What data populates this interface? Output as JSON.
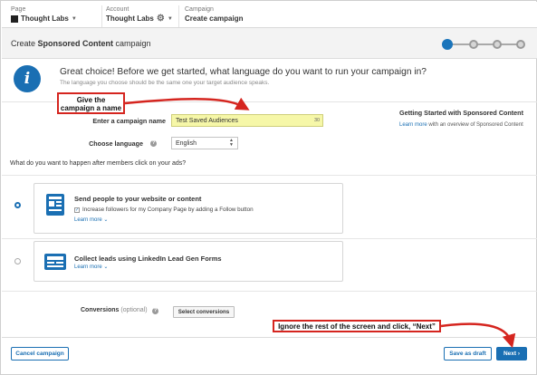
{
  "breadcrumb": {
    "page_label": "Page",
    "page_value": "Thought Labs",
    "account_label": "Account",
    "account_value": "Thought Labs",
    "campaign_label": "Campaign",
    "campaign_value": "Create campaign"
  },
  "header": {
    "title_prefix": "Create ",
    "title_bold": "Sponsored Content",
    "title_suffix": " campaign",
    "progress": {
      "current_step": 1,
      "total_steps": 4
    }
  },
  "banner": {
    "heading": "Great choice! Before we get started, what language do you want to run your campaign in?",
    "subtext": "The language you choose should be the same one your target audience speaks."
  },
  "annotations": {
    "name_hint": "Give the campaign a name",
    "next_hint": "Ignore the rest of the screen and click, “Next”"
  },
  "form": {
    "name_label": "Enter a campaign name",
    "name_value": "Test Saved Audiences",
    "name_remaining": "30",
    "language_label": "Choose language",
    "language_value": "English",
    "question": "What do you want to happen after members click on your ads?"
  },
  "sidebar": {
    "heading": "Getting Started with Sponsored Content",
    "link_text": "Learn more",
    "link_suffix": " with an overview of Sponsored Content"
  },
  "options": [
    {
      "title": "Send people to your website or content",
      "checkbox_label": "Increase followers for my Company Page by adding a Follow button",
      "learn_more": "Learn more",
      "selected": true
    },
    {
      "title": "Collect leads using LinkedIn Lead Gen Forms",
      "learn_more": "Learn more",
      "selected": false
    }
  ],
  "conversions": {
    "label": "Conversions",
    "optional": "(optional)",
    "button": "Select conversions"
  },
  "footer": {
    "cancel": "Cancel campaign",
    "save_draft": "Save as draft",
    "next": "Next"
  },
  "colors": {
    "accent": "#1a6fb3",
    "annotation": "#d5251f",
    "highlight_input": "#f6f7a8"
  }
}
